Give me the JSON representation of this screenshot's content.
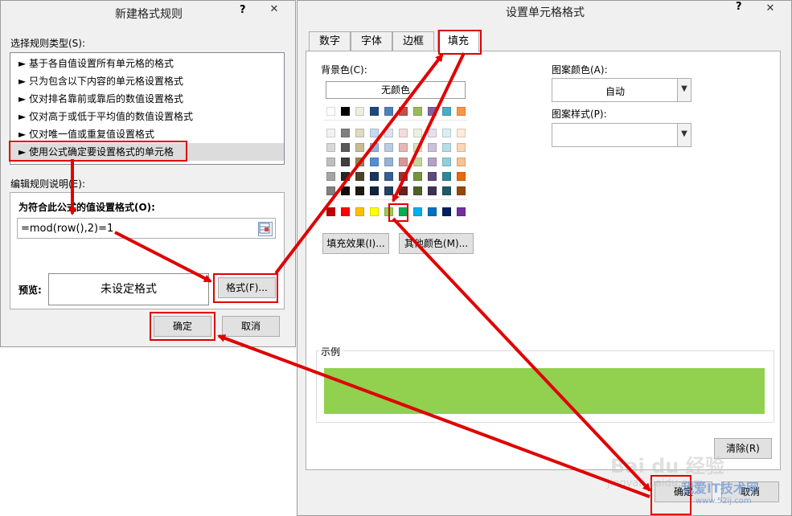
{
  "left_dialog": {
    "title": "新建格式规则",
    "help": "?",
    "close": "✕",
    "rule_type_label": "选择规则类型(S):",
    "rule_types": [
      "► 基于各自值设置所有单元格的格式",
      "► 只为包含以下内容的单元格设置格式",
      "► 仅对排名靠前或靠后的数值设置格式",
      "► 仅对高于或低于平均值的数值设置格式",
      "► 仅对唯一值或重复值设置格式",
      "► 使用公式确定要设置格式的单元格"
    ],
    "edit_label": "编辑规则说明(E):",
    "formula_label": "为符合此公式的值设置格式(O):",
    "formula_value": "=mod(row(),2)=1",
    "preview_label": "预览:",
    "preview_text": "未设定格式",
    "format_button": "格式(F)...",
    "ok": "确定",
    "cancel": "取消"
  },
  "right_dialog": {
    "title": "设置单元格格式",
    "help": "?",
    "close": "✕",
    "tabs": [
      "数字",
      "字体",
      "边框",
      "填充"
    ],
    "active_tab": "填充",
    "bg_color_label": "背景色(C):",
    "no_color": "无颜色",
    "pattern_color_label": "图案颜色(A):",
    "pattern_color_value": "自动",
    "pattern_style_label": "图案样式(P):",
    "pattern_style_value": "",
    "fill_effects": "填充效果(I)...",
    "more_colors": "其他颜色(M)...",
    "sample_label": "示例",
    "sample_color": "#92d050",
    "clear": "清除(R)",
    "ok": "确定",
    "cancel": "取消",
    "palette": {
      "theme_top": [
        "#ffffff",
        "#000000",
        "#eeece1",
        "#1f497d",
        "#4f81bd",
        "#c0504d",
        "#9bbb59",
        "#8064a2",
        "#4bacc6",
        "#f79646"
      ],
      "tints": [
        [
          "#f2f2f2",
          "#7f7f7f",
          "#ddd9c3",
          "#c6d9f0",
          "#dbe5f1",
          "#f2dcdb",
          "#ebf1dd",
          "#e5e0ec",
          "#dbeef3",
          "#fdeada"
        ],
        [
          "#d8d8d8",
          "#595959",
          "#c4bd97",
          "#8db3e2",
          "#b8cce4",
          "#e5b9b7",
          "#d7e3bc",
          "#ccc1d9",
          "#b7dde8",
          "#fbd5b5"
        ],
        [
          "#bfbfbf",
          "#3f3f3f",
          "#938953",
          "#548dd4",
          "#95b3d7",
          "#d99694",
          "#c3d69b",
          "#b2a2c7",
          "#92cddc",
          "#fac08f"
        ],
        [
          "#a5a5a5",
          "#262626",
          "#494429",
          "#17365d",
          "#366092",
          "#953734",
          "#76923c",
          "#5f497a",
          "#31859b",
          "#e36c09"
        ],
        [
          "#7f7f7f",
          "#0c0c0c",
          "#1d1b10",
          "#0f243e",
          "#244061",
          "#632423",
          "#4f6128",
          "#3f3151",
          "#205867",
          "#974806"
        ]
      ],
      "standard": [
        "#c00000",
        "#ff0000",
        "#ffc000",
        "#ffff00",
        "#92d050",
        "#00b050",
        "#00b0f0",
        "#0070c0",
        "#002060",
        "#7030a0"
      ]
    }
  },
  "watermark": {
    "logo": "Bai du 经验",
    "url": "jingyan.baidu.com",
    "site": "我爱IT技术网",
    "site_url": "www.52ij.com"
  },
  "colors": {
    "highlight": "#e00000",
    "selected_row": "#dcdcdc",
    "dialog_bg": "#f0f0f0"
  }
}
